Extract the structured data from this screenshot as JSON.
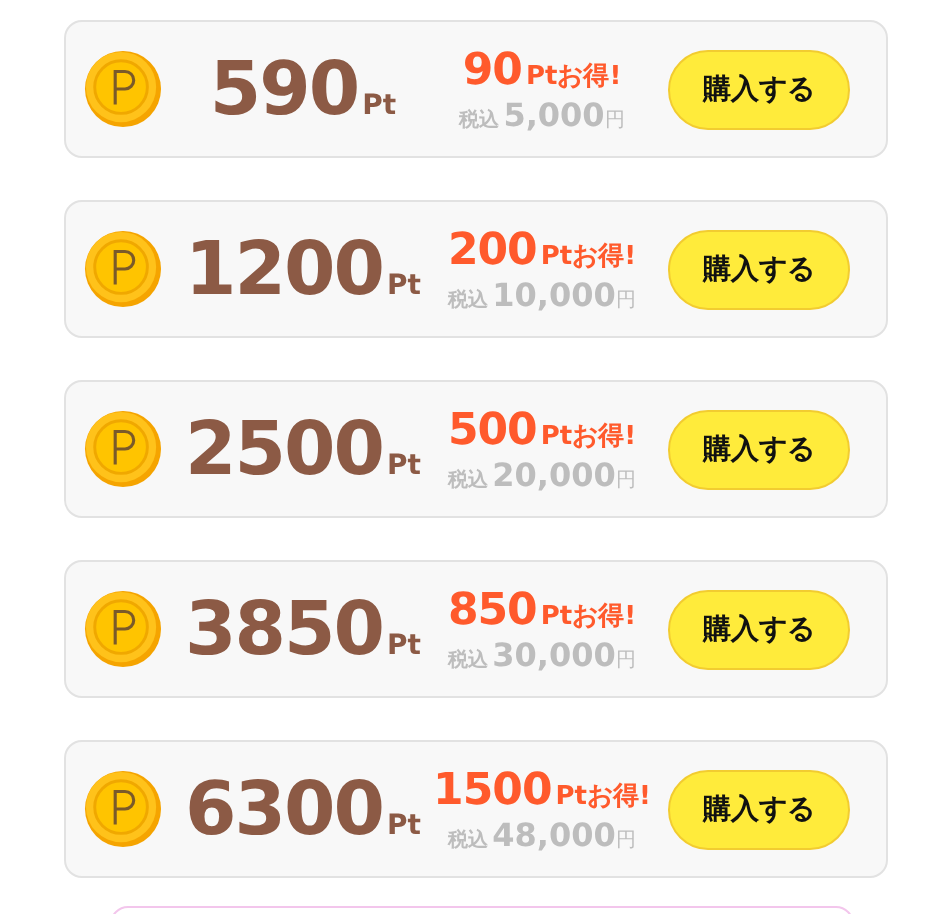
{
  "packages": [
    {
      "points": "590",
      "points_unit": "Pt",
      "bonus": "90",
      "bonus_unit": "Ptお得!",
      "tax_label": "税込",
      "price": "5,000",
      "currency": "円",
      "button": "購入する"
    },
    {
      "points": "1200",
      "points_unit": "Pt",
      "bonus": "200",
      "bonus_unit": "Ptお得!",
      "tax_label": "税込",
      "price": "10,000",
      "currency": "円",
      "button": "購入する"
    },
    {
      "points": "2500",
      "points_unit": "Pt",
      "bonus": "500",
      "bonus_unit": "Ptお得!",
      "tax_label": "税込",
      "price": "20,000",
      "currency": "円",
      "button": "購入する"
    },
    {
      "points": "3850",
      "points_unit": "Pt",
      "bonus": "850",
      "bonus_unit": "Ptお得!",
      "tax_label": "税込",
      "price": "30,000",
      "currency": "円",
      "button": "購入する"
    },
    {
      "points": "6300",
      "points_unit": "Pt",
      "bonus": "1500",
      "bonus_unit": "Ptお得!",
      "tax_label": "税込",
      "price": "48,000",
      "currency": "円",
      "button": "購入する"
    }
  ]
}
